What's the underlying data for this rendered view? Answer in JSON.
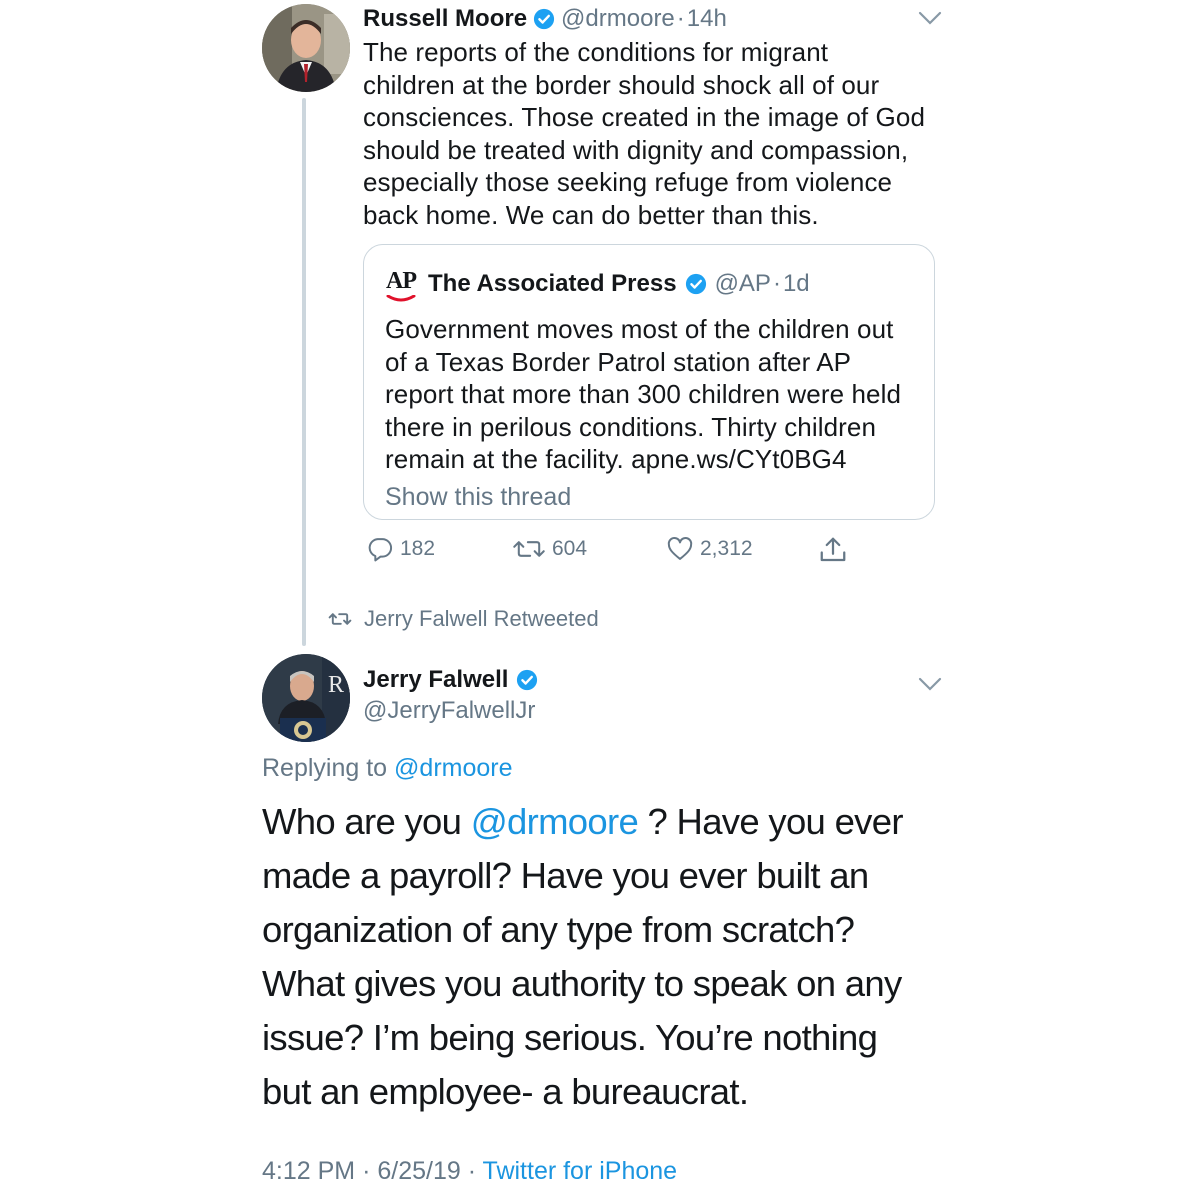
{
  "tweet1": {
    "name": "Russell Moore",
    "handle": "@drmoore",
    "time": "14h",
    "lines": [
      "The reports of the conditions for migrant",
      "children at the border should shock all of our",
      "consciences. Those created in the image of God",
      "should be treated with dignity and compassion,",
      "especially those seeking refuge from violence",
      "back home. We can do better than this."
    ],
    "quote": {
      "logo": "AP",
      "name": "The Associated Press",
      "handle": "@AP",
      "time": "1d",
      "lines": [
        "Government moves most of the children out",
        "of a Texas Border Patrol station after AP",
        "report that more than 300 children were held",
        "there in perilous conditions. Thirty children",
        "remain at the facility. apne.ws/CYt0BG4"
      ],
      "show_thread": "Show this thread"
    },
    "actions": {
      "replies": "182",
      "retweets": "604",
      "likes": "2,312"
    },
    "icons": [
      "verified-badge-icon",
      "chevron-down-icon",
      "reply-icon",
      "retweet-icon",
      "like-icon",
      "share-icon"
    ]
  },
  "retweet_banner": "Jerry Falwell Retweeted",
  "tweet2": {
    "name": "Jerry Falwell",
    "handle": "@JerryFalwellJr",
    "replying_prefix": "Replying to",
    "replying_to": "@drmoore",
    "body": {
      "line1_before": "Who are you",
      "line1_mention": "@drmoore",
      "line1_after": " ?  Have you ever",
      "lines": [
        "made a payroll?  Have you ever built an",
        "organization of any type from scratch?",
        "What gives you authority to speak on any",
        "issue?  I’m being serious.  You’re nothing",
        "but an employee- a bureaucrat."
      ]
    },
    "time": "4:12 PM",
    "date": "6/25/19",
    "source": "Twitter for iPhone"
  },
  "colors": {
    "link": "#1b95e0",
    "muted": "#657786",
    "text": "#14171a",
    "verified": "#1da1f2",
    "ap_red": "#e0112b",
    "thread_line": "#ccd6dd"
  }
}
